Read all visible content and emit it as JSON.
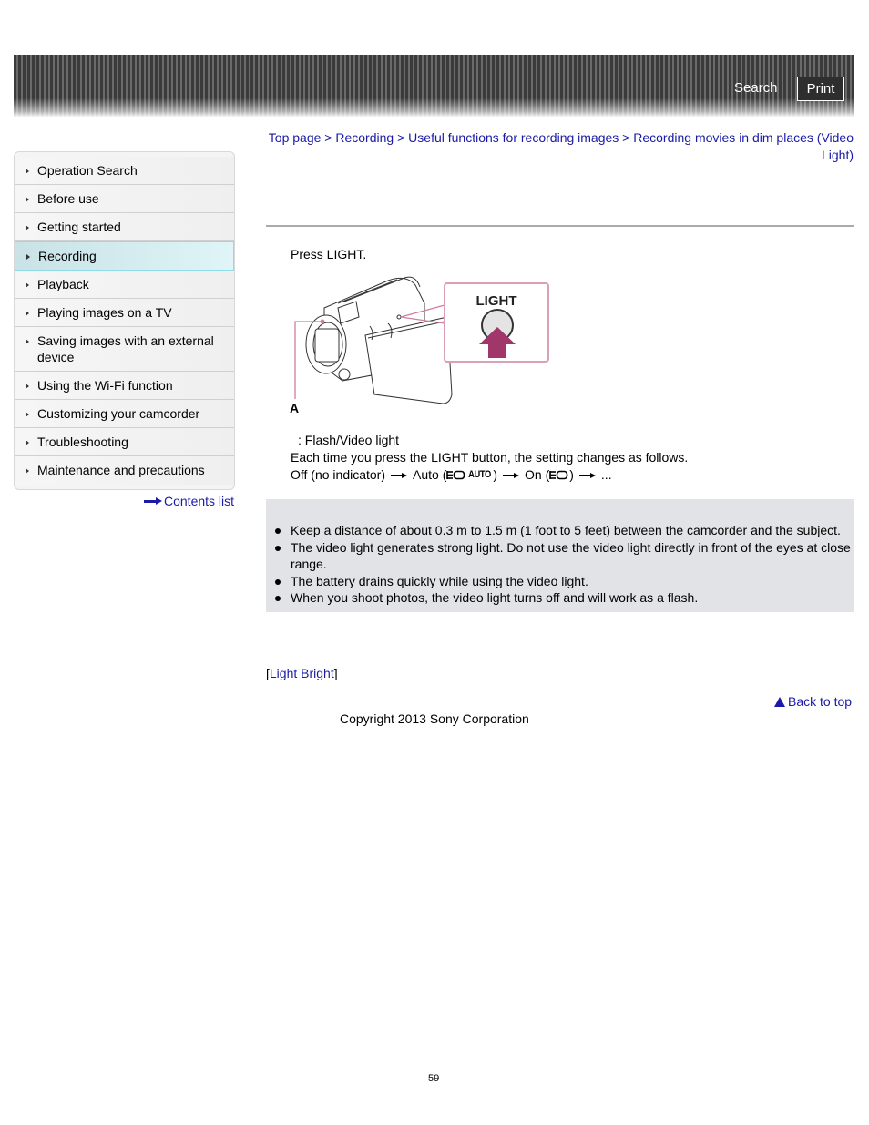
{
  "header": {
    "search_label": "Search",
    "print_label": "Print"
  },
  "sidebar": {
    "items": [
      {
        "label": "Operation Search",
        "active": false
      },
      {
        "label": "Before use",
        "active": false
      },
      {
        "label": "Getting started",
        "active": false
      },
      {
        "label": "Recording",
        "active": true
      },
      {
        "label": "Playback",
        "active": false
      },
      {
        "label": "Playing images on a TV",
        "active": false
      },
      {
        "label": "Saving images with an external device",
        "active": false
      },
      {
        "label": "Using the Wi-Fi function",
        "active": false
      },
      {
        "label": "Customizing your camcorder",
        "active": false
      },
      {
        "label": "Troubleshooting",
        "active": false
      },
      {
        "label": "Maintenance and precautions",
        "active": false
      }
    ],
    "contents_list_label": "Contents list"
  },
  "breadcrumb": {
    "items": [
      "Top page",
      "Recording",
      "Useful functions for recording images",
      "Recording movies in dim places (Video Light)"
    ],
    "separator": ">"
  },
  "main": {
    "step": "Press LIGHT.",
    "illustration": {
      "button_label": "LIGHT",
      "callout_label": "A"
    },
    "legend": ": Flash/Video light",
    "desc_line": "Each time you press the LIGHT button, the setting changes as follows.",
    "sequence": {
      "off": "Off (no indicator)",
      "auto_prefix": "Auto (",
      "auto_icon_text": "AUTO",
      "auto_suffix": ")",
      "on_prefix": "On (",
      "on_suffix": ")",
      "ellipsis": "..."
    },
    "notes": [
      "Keep a distance of about 0.3 m to 1.5 m (1 foot to 5 feet) between the camcorder and the subject.",
      "The video light generates strong light. Do not use the video light directly in front of the eyes at close range.",
      "The battery drains quickly while using the video light.",
      "When you shoot photos, the video light turns off and will work as a flash."
    ],
    "related": {
      "open": "[",
      "link": "Light Bright",
      "close": "]"
    }
  },
  "footer": {
    "back_to_top": "Back to top",
    "copyright": "Copyright 2013 Sony Corporation",
    "page_number": "59"
  },
  "colors": {
    "link": "#1a1aa6",
    "accent_pink": "#d9a0b8",
    "arrow_magenta": "#a0366a",
    "notes_bg": "#e1e3e6",
    "active_nav": "#c8e2e6"
  }
}
